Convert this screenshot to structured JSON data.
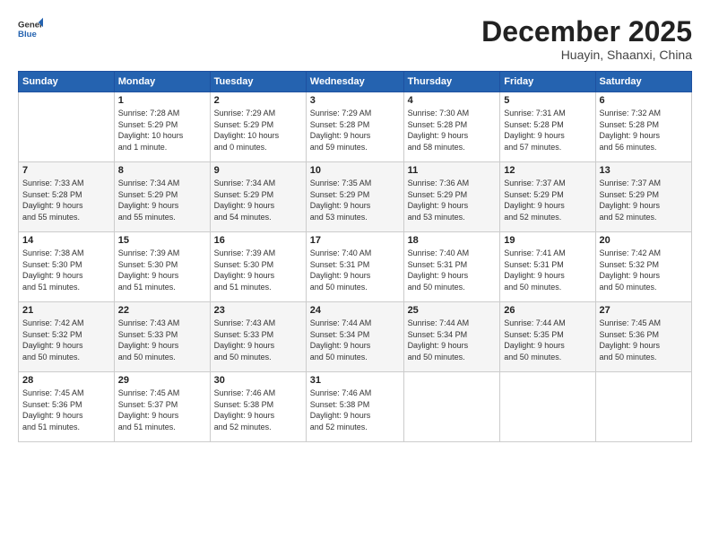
{
  "logo": {
    "general": "General",
    "blue": "Blue"
  },
  "title": "December 2025",
  "location": "Huayin, Shaanxi, China",
  "weekdays": [
    "Sunday",
    "Monday",
    "Tuesday",
    "Wednesday",
    "Thursday",
    "Friday",
    "Saturday"
  ],
  "weeks": [
    [
      {
        "day": "",
        "detail": ""
      },
      {
        "day": "1",
        "detail": "Sunrise: 7:28 AM\nSunset: 5:29 PM\nDaylight: 10 hours\nand 1 minute."
      },
      {
        "day": "2",
        "detail": "Sunrise: 7:29 AM\nSunset: 5:29 PM\nDaylight: 10 hours\nand 0 minutes."
      },
      {
        "day": "3",
        "detail": "Sunrise: 7:29 AM\nSunset: 5:28 PM\nDaylight: 9 hours\nand 59 minutes."
      },
      {
        "day": "4",
        "detail": "Sunrise: 7:30 AM\nSunset: 5:28 PM\nDaylight: 9 hours\nand 58 minutes."
      },
      {
        "day": "5",
        "detail": "Sunrise: 7:31 AM\nSunset: 5:28 PM\nDaylight: 9 hours\nand 57 minutes."
      },
      {
        "day": "6",
        "detail": "Sunrise: 7:32 AM\nSunset: 5:28 PM\nDaylight: 9 hours\nand 56 minutes."
      }
    ],
    [
      {
        "day": "7",
        "detail": "Sunrise: 7:33 AM\nSunset: 5:28 PM\nDaylight: 9 hours\nand 55 minutes."
      },
      {
        "day": "8",
        "detail": "Sunrise: 7:34 AM\nSunset: 5:29 PM\nDaylight: 9 hours\nand 55 minutes."
      },
      {
        "day": "9",
        "detail": "Sunrise: 7:34 AM\nSunset: 5:29 PM\nDaylight: 9 hours\nand 54 minutes."
      },
      {
        "day": "10",
        "detail": "Sunrise: 7:35 AM\nSunset: 5:29 PM\nDaylight: 9 hours\nand 53 minutes."
      },
      {
        "day": "11",
        "detail": "Sunrise: 7:36 AM\nSunset: 5:29 PM\nDaylight: 9 hours\nand 53 minutes."
      },
      {
        "day": "12",
        "detail": "Sunrise: 7:37 AM\nSunset: 5:29 PM\nDaylight: 9 hours\nand 52 minutes."
      },
      {
        "day": "13",
        "detail": "Sunrise: 7:37 AM\nSunset: 5:29 PM\nDaylight: 9 hours\nand 52 minutes."
      }
    ],
    [
      {
        "day": "14",
        "detail": "Sunrise: 7:38 AM\nSunset: 5:30 PM\nDaylight: 9 hours\nand 51 minutes."
      },
      {
        "day": "15",
        "detail": "Sunrise: 7:39 AM\nSunset: 5:30 PM\nDaylight: 9 hours\nand 51 minutes."
      },
      {
        "day": "16",
        "detail": "Sunrise: 7:39 AM\nSunset: 5:30 PM\nDaylight: 9 hours\nand 51 minutes."
      },
      {
        "day": "17",
        "detail": "Sunrise: 7:40 AM\nSunset: 5:31 PM\nDaylight: 9 hours\nand 50 minutes."
      },
      {
        "day": "18",
        "detail": "Sunrise: 7:40 AM\nSunset: 5:31 PM\nDaylight: 9 hours\nand 50 minutes."
      },
      {
        "day": "19",
        "detail": "Sunrise: 7:41 AM\nSunset: 5:31 PM\nDaylight: 9 hours\nand 50 minutes."
      },
      {
        "day": "20",
        "detail": "Sunrise: 7:42 AM\nSunset: 5:32 PM\nDaylight: 9 hours\nand 50 minutes."
      }
    ],
    [
      {
        "day": "21",
        "detail": "Sunrise: 7:42 AM\nSunset: 5:32 PM\nDaylight: 9 hours\nand 50 minutes."
      },
      {
        "day": "22",
        "detail": "Sunrise: 7:43 AM\nSunset: 5:33 PM\nDaylight: 9 hours\nand 50 minutes."
      },
      {
        "day": "23",
        "detail": "Sunrise: 7:43 AM\nSunset: 5:33 PM\nDaylight: 9 hours\nand 50 minutes."
      },
      {
        "day": "24",
        "detail": "Sunrise: 7:44 AM\nSunset: 5:34 PM\nDaylight: 9 hours\nand 50 minutes."
      },
      {
        "day": "25",
        "detail": "Sunrise: 7:44 AM\nSunset: 5:34 PM\nDaylight: 9 hours\nand 50 minutes."
      },
      {
        "day": "26",
        "detail": "Sunrise: 7:44 AM\nSunset: 5:35 PM\nDaylight: 9 hours\nand 50 minutes."
      },
      {
        "day": "27",
        "detail": "Sunrise: 7:45 AM\nSunset: 5:36 PM\nDaylight: 9 hours\nand 50 minutes."
      }
    ],
    [
      {
        "day": "28",
        "detail": "Sunrise: 7:45 AM\nSunset: 5:36 PM\nDaylight: 9 hours\nand 51 minutes."
      },
      {
        "day": "29",
        "detail": "Sunrise: 7:45 AM\nSunset: 5:37 PM\nDaylight: 9 hours\nand 51 minutes."
      },
      {
        "day": "30",
        "detail": "Sunrise: 7:46 AM\nSunset: 5:38 PM\nDaylight: 9 hours\nand 52 minutes."
      },
      {
        "day": "31",
        "detail": "Sunrise: 7:46 AM\nSunset: 5:38 PM\nDaylight: 9 hours\nand 52 minutes."
      },
      {
        "day": "",
        "detail": ""
      },
      {
        "day": "",
        "detail": ""
      },
      {
        "day": "",
        "detail": ""
      }
    ]
  ]
}
